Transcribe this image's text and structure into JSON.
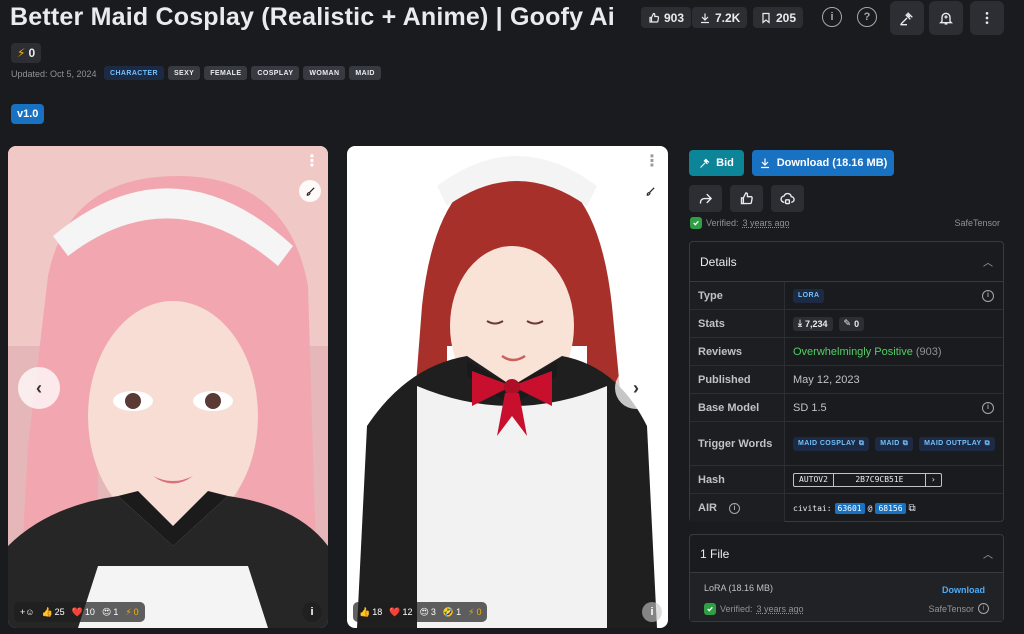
{
  "header": {
    "title": "Better Maid Cosplay (Realistic + Anime) | Goofy Ai",
    "likes": "903",
    "downloads": "7.2K",
    "bookmarks": "205",
    "buzz": "0",
    "updated": "Updated: Oct 5, 2024"
  },
  "tags": [
    "CHARACTER",
    "SEXY",
    "FEMALE",
    "COSPLAY",
    "WOMAN",
    "MAID"
  ],
  "version": "v1.0",
  "gallery": {
    "card1": {
      "r1": "25",
      "r2": "10",
      "r3": "1",
      "r4": "0"
    },
    "card2": {
      "r1": "18",
      "r2": "12",
      "r3": "3",
      "r4": "1",
      "r5": "0"
    }
  },
  "actions": {
    "bid": "Bid",
    "download": "Download (18.16 MB)",
    "verified_label": "Verified:",
    "verified_time": "3 years ago",
    "safetensor": "SafeTensor"
  },
  "details": {
    "header": "Details",
    "type_label": "Type",
    "type_value": "LORA",
    "stats_label": "Stats",
    "stats_downloads": "7,234",
    "stats_buzz": "0",
    "reviews_label": "Reviews",
    "reviews_value": "Overwhelmingly Positive",
    "reviews_count": "(903)",
    "published_label": "Published",
    "published_value": "May 12, 2023",
    "base_label": "Base Model",
    "base_value": "SD 1.5",
    "trigger_label": "Trigger Words",
    "triggers": [
      "MAID COSPLAY",
      "MAID",
      "MAID OUTPLAY"
    ],
    "hash_label": "Hash",
    "hash_type": "AUTOV2",
    "hash_value": "2B7C9CB51E",
    "air_label": "AIR",
    "air_prefix": "civitai:",
    "air_id1": "63601",
    "air_at": "@",
    "air_id2": "68156"
  },
  "files": {
    "header": "1 File",
    "name": "LoRA (18.16 MB)",
    "download": "Download",
    "verified_label": "Verified:",
    "verified_time": "3 years ago",
    "safetensor": "SafeTensor"
  },
  "colors": {
    "background": "#1a1b1e",
    "accent_blue": "#1971c2",
    "bid_teal": "#0c8599",
    "positive": "#51cf66"
  }
}
